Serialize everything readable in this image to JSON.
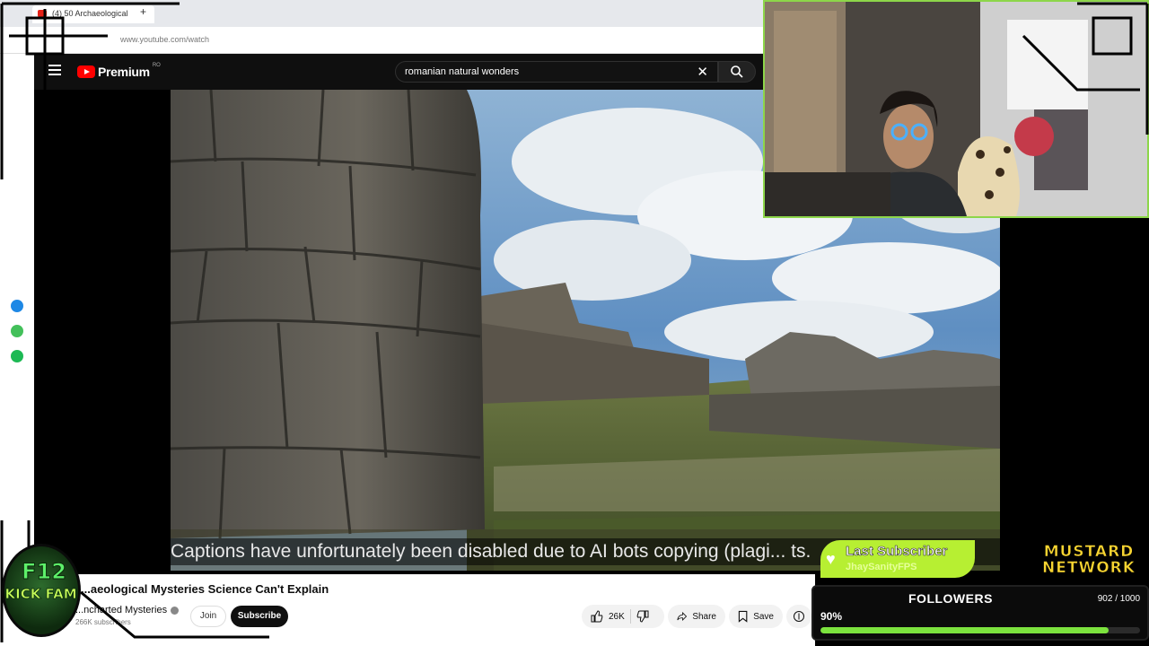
{
  "browser": {
    "tab_title": "(4) 50 Archaeological",
    "new_tab": "+",
    "url": "www.youtube.com/watch"
  },
  "youtube": {
    "logo_text": "Premium",
    "country_code": "RO",
    "search_query": "romanian natural wonders",
    "clear_symbol": "✕"
  },
  "video": {
    "caption": "Captions have unfortunately been disabled due to AI bots copying (plagi... ts."
  },
  "details": {
    "title": "...aeological Mysteries Science Can't Explain",
    "channel": "...ncharted Mysteries",
    "subscribers": "266K subscribers",
    "join_label": "Join",
    "subscribe_label": "Subscribe",
    "likes": "26K",
    "share_label": "Share",
    "save_label": "Save"
  },
  "overlay": {
    "last_subscriber_title": "Last Subscriber",
    "last_subscriber_name": "JhaySanityFPS",
    "mustard_line1": "MUSTARD",
    "mustard_line2": "NETWORK",
    "followers_title": "FOLLOWERS",
    "followers_count": "902 / 1000",
    "followers_percent": "90%",
    "followers_progress": 0.902,
    "badge_line1": "F12",
    "badge_line2": "KICK FAM!"
  },
  "colors": {
    "youtube_red": "#ff0000",
    "follower_bar": "#7ce33e",
    "last_sub_bg": "#b7ef32",
    "mustard": "#f7d431",
    "webcam_border": "#8dd64a"
  },
  "icons": [
    "hamburger-icon",
    "search-icon",
    "like-icon",
    "dislike-icon",
    "share-icon",
    "save-icon",
    "messenger-icon",
    "whatsapp-icon",
    "spotify-icon",
    "heart-icon"
  ]
}
